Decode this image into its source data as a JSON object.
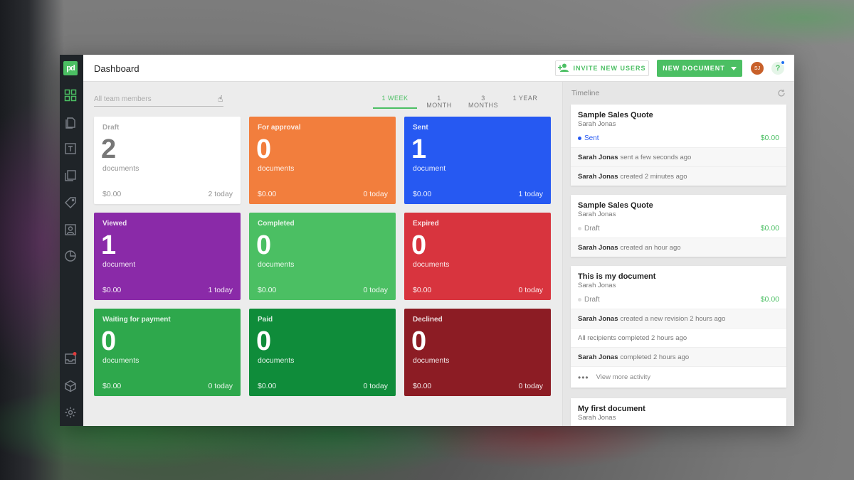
{
  "header": {
    "title": "Dashboard",
    "invite_label": "INVITE NEW USERS",
    "new_document_label": "NEW DOCUMENT",
    "avatar_initials": "SJ",
    "help_label": "?"
  },
  "brand": {
    "logo_text": "pd",
    "accent": "#4bbf63"
  },
  "filters": {
    "team_placeholder": "All team members",
    "periods": [
      "1 WEEK",
      "1 MONTH",
      "3 MONTHS",
      "1 YEAR"
    ],
    "active_period": "1 WEEK"
  },
  "sidebar": {
    "items": [
      {
        "icon": "grid-icon",
        "active": true
      },
      {
        "icon": "documents-icon"
      },
      {
        "icon": "template-icon"
      },
      {
        "icon": "content-library-icon"
      },
      {
        "icon": "tag-icon"
      },
      {
        "icon": "contacts-icon"
      },
      {
        "icon": "reports-icon"
      }
    ],
    "bottom": [
      {
        "icon": "inbox-icon",
        "has_notification": true
      },
      {
        "icon": "cube-icon"
      },
      {
        "icon": "gear-icon"
      }
    ]
  },
  "cards": [
    {
      "label": "Draft",
      "count": "2",
      "unit": "documents",
      "amount": "$0.00",
      "today": "2 today",
      "color": "#ffffff"
    },
    {
      "label": "For approval",
      "count": "0",
      "unit": "documents",
      "amount": "$0.00",
      "today": "0 today",
      "color": "#f27e3d"
    },
    {
      "label": "Sent",
      "count": "1",
      "unit": "document",
      "amount": "$0.00",
      "today": "1 today",
      "color": "#2659f2"
    },
    {
      "label": "Viewed",
      "count": "1",
      "unit": "document",
      "amount": "$0.00",
      "today": "1 today",
      "color": "#8a2aa8"
    },
    {
      "label": "Completed",
      "count": "0",
      "unit": "documents",
      "amount": "$0.00",
      "today": "0 today",
      "color": "#4bbf63"
    },
    {
      "label": "Expired",
      "count": "0",
      "unit": "documents",
      "amount": "$0.00",
      "today": "0 today",
      "color": "#d8343e"
    },
    {
      "label": "Waiting for payment",
      "count": "0",
      "unit": "documents",
      "amount": "$0.00",
      "today": "0 today",
      "color": "#2ea84c"
    },
    {
      "label": "Paid",
      "count": "0",
      "unit": "documents",
      "amount": "$0.00",
      "today": "0 today",
      "color": "#0f8c3a"
    },
    {
      "label": "Declined",
      "count": "0",
      "unit": "documents",
      "amount": "$0.00",
      "today": "0 today",
      "color": "#8c1c24"
    }
  ],
  "timeline": {
    "title": "Timeline",
    "more_label": "View more activity",
    "entries": [
      {
        "name": "Sample Sales Quote",
        "author": "Sarah Jonas",
        "status": "Sent",
        "status_color": "#2659f2",
        "amount": "$0.00",
        "activity": [
          {
            "who": "Sarah Jonas",
            "what": "sent a few seconds ago"
          },
          {
            "who": "Sarah Jonas",
            "what": "created 2 minutes ago"
          }
        ]
      },
      {
        "name": "Sample Sales Quote",
        "author": "Sarah Jonas",
        "status": "Draft",
        "status_color": "#dddddd",
        "amount": "$0.00",
        "activity": [
          {
            "who": "Sarah Jonas",
            "what": "created an hour ago"
          }
        ]
      },
      {
        "name": "This is my document",
        "author": "Sarah Jonas",
        "status": "Draft",
        "status_color": "#dddddd",
        "amount": "$0.00",
        "activity": [
          {
            "who": "Sarah Jonas",
            "what": "created a new revision 2 hours ago"
          },
          {
            "who": "",
            "what": "All recipients completed 2 hours ago"
          },
          {
            "who": "Sarah Jonas",
            "what": "completed 2 hours ago"
          }
        ],
        "show_more": true
      },
      {
        "name": "My first document",
        "author": "Sarah Jonas"
      }
    ]
  }
}
